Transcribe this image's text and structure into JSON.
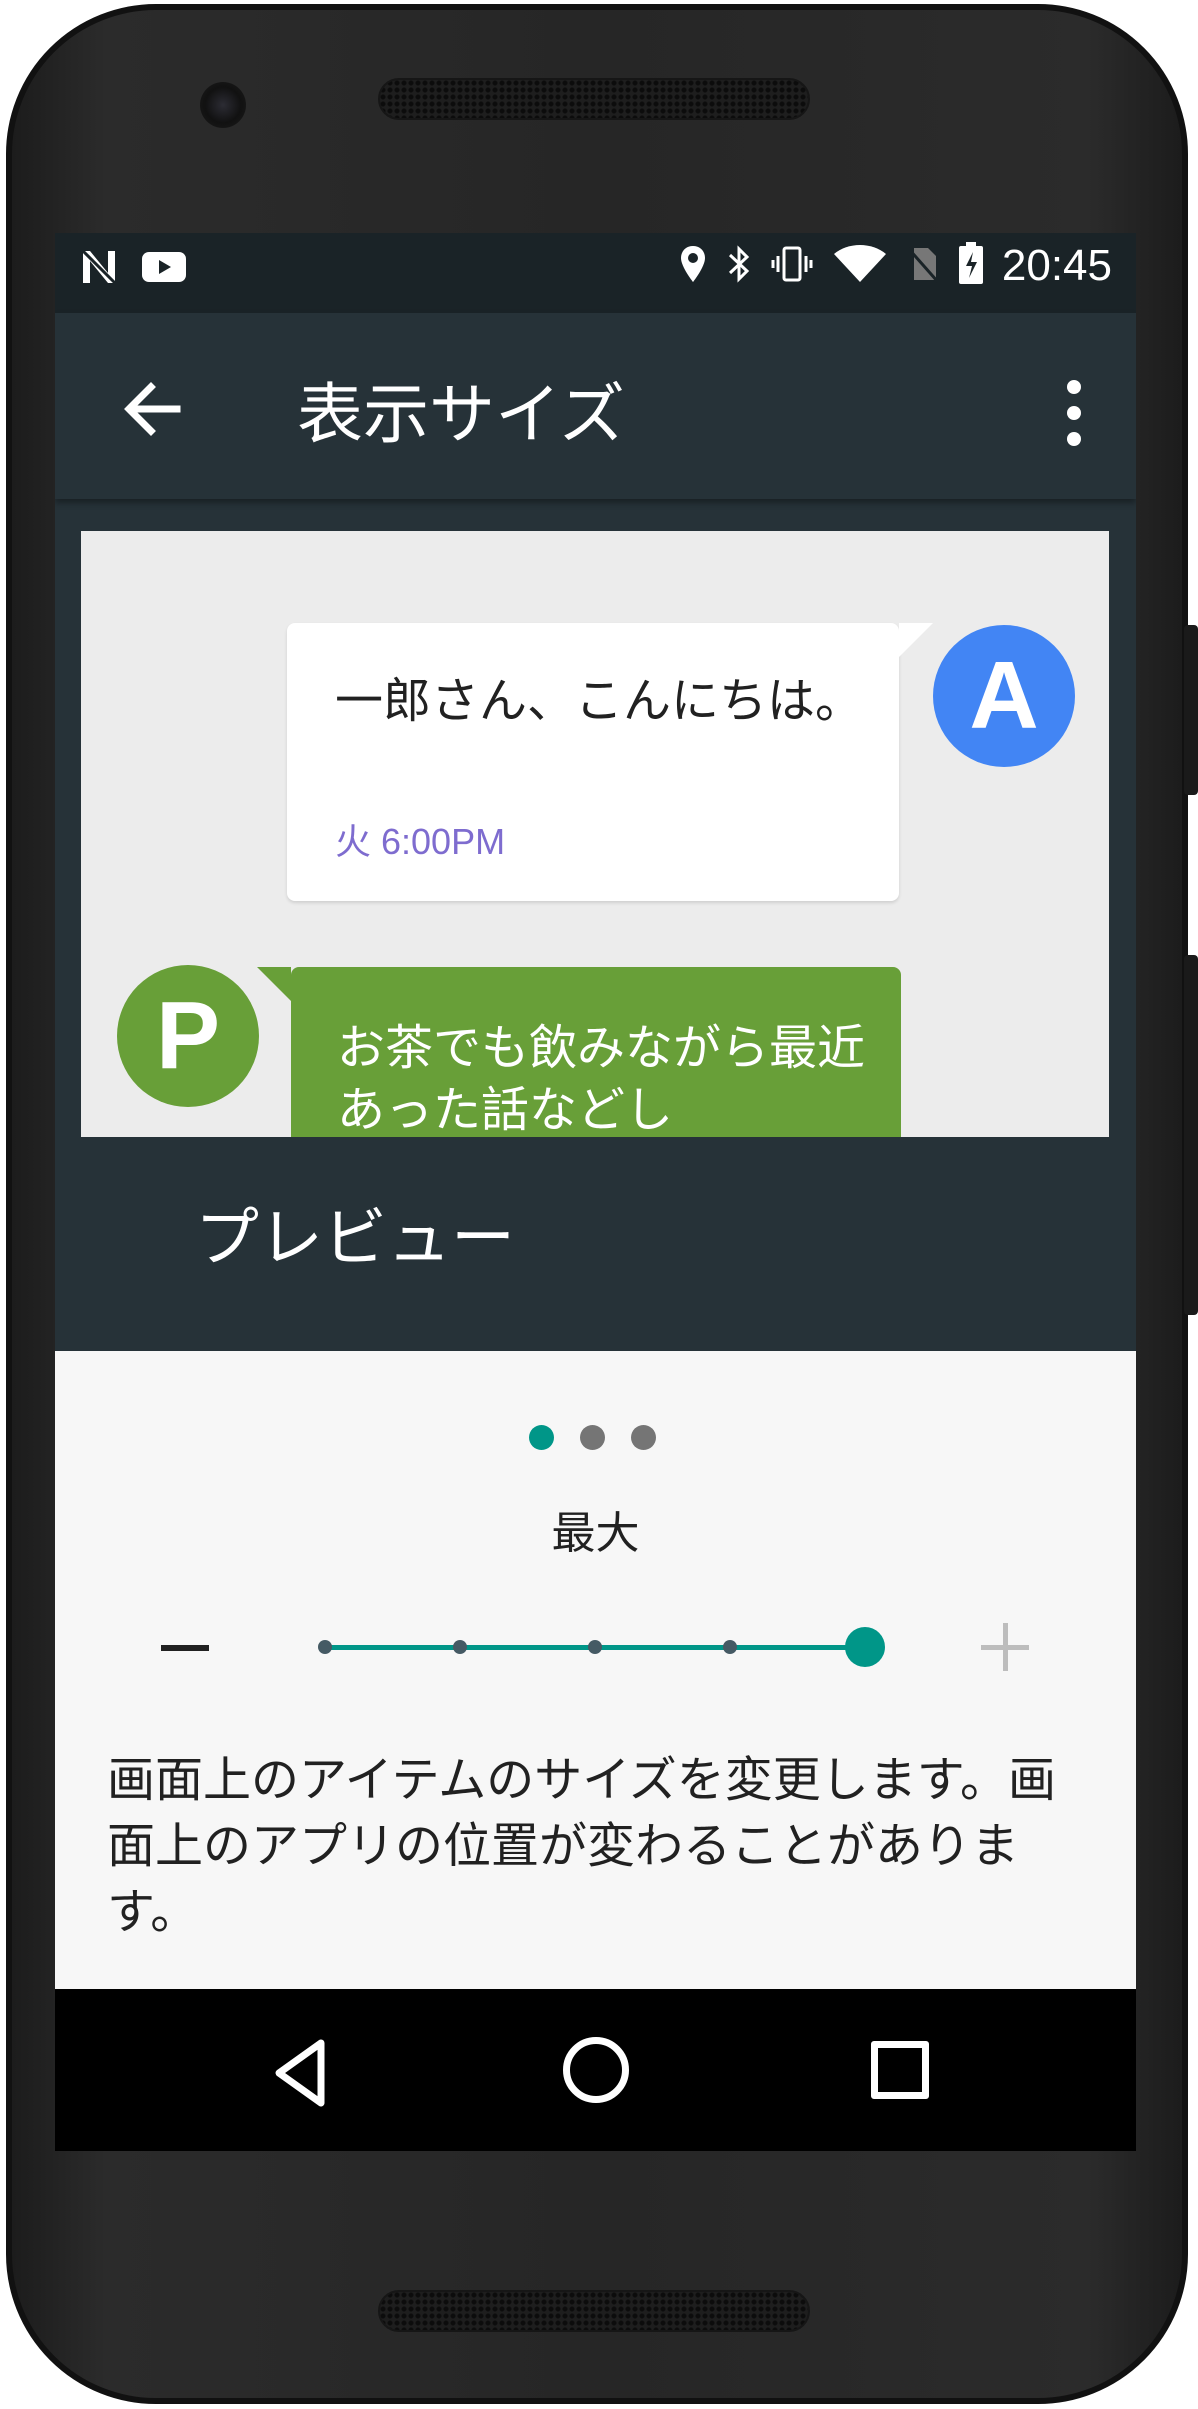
{
  "status_bar": {
    "time": "20:45",
    "left_icons": [
      "n-notification-icon",
      "youtube-icon"
    ],
    "right_icons": [
      "location-icon",
      "bluetooth-icon",
      "vibrate-icon",
      "wifi-icon",
      "no-sim-icon",
      "battery-icon"
    ]
  },
  "app_bar": {
    "title": "表示サイズ",
    "back_icon": "arrow-back-icon",
    "menu_icon": "more-vert-icon"
  },
  "preview": {
    "incoming_message": {
      "avatar_letter": "A",
      "avatar_color": "#4285f4",
      "text": "一郎さん、こんにちは。",
      "time": "火 6:00PM"
    },
    "outgoing_message": {
      "avatar_letter": "P",
      "avatar_color": "#689f38",
      "text": "お茶でも飲みながら最近あった話などし"
    },
    "label": "プレビュー"
  },
  "size_control": {
    "page_dots": 3,
    "active_page": 0,
    "current_size_label": "最大",
    "steps": 5,
    "current_step": 5,
    "decrease_label": "−",
    "increase_label": "+",
    "accent_color": "#009688"
  },
  "description": "画面上のアイテムのサイズを変更します。画面上のアプリの位置が変わることがあります。",
  "navigation_bar": {
    "buttons": [
      "back-triangle-icon",
      "home-circle-icon",
      "recents-square-icon"
    ]
  }
}
